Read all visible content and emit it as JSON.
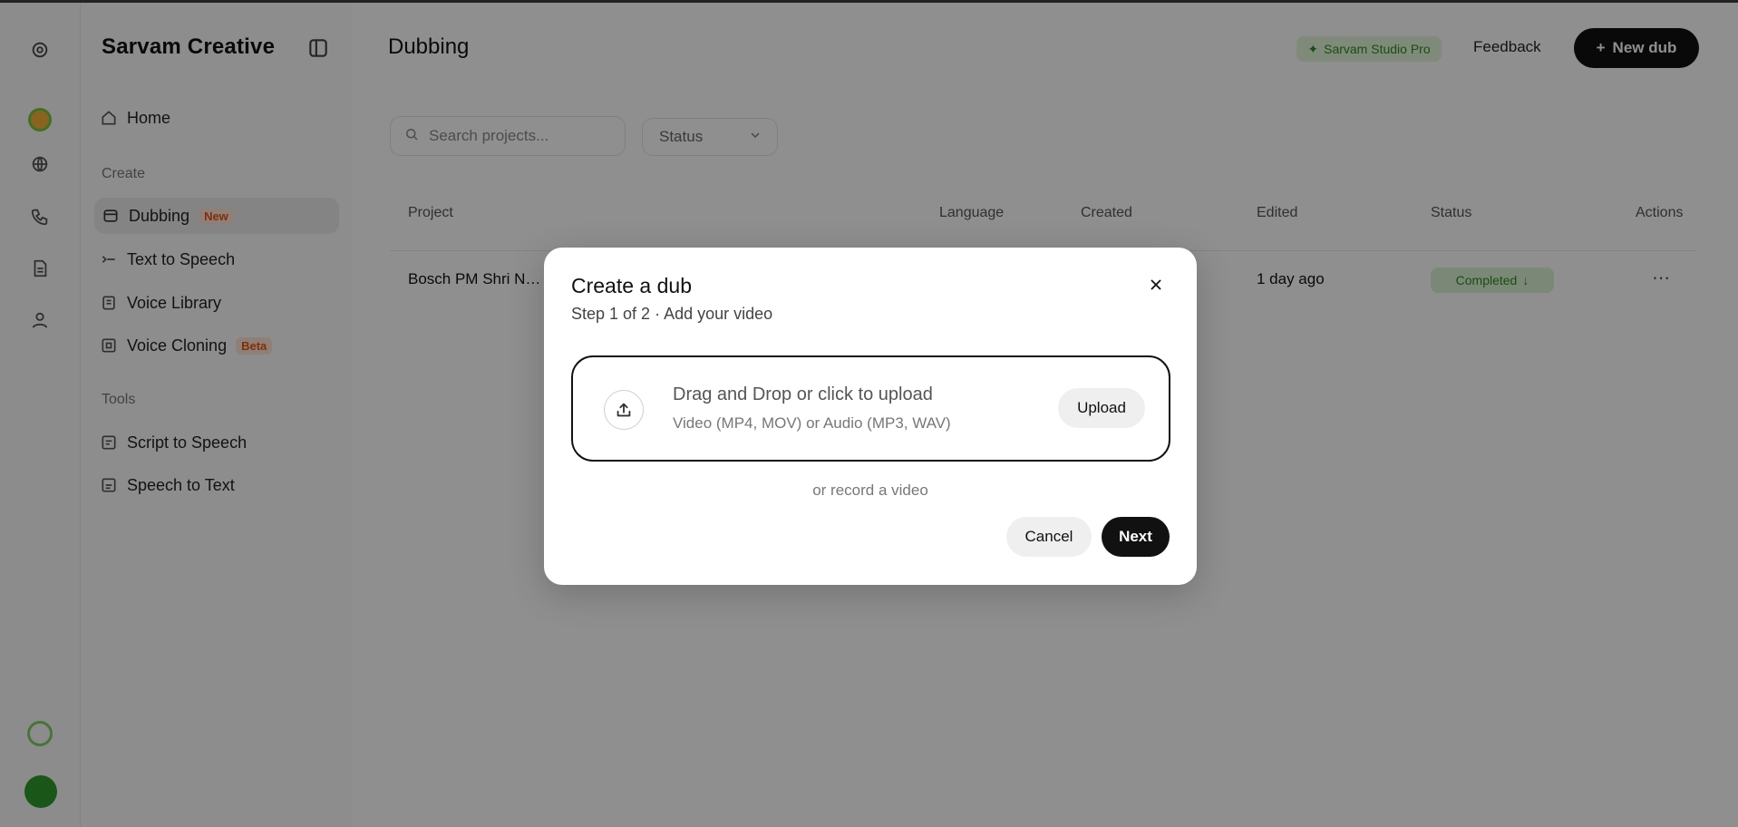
{
  "app": {
    "brand": "Sarvam Creative",
    "page_title": "Dubbing"
  },
  "header": {
    "credits_pill": "Sarvam Studio Pro",
    "feedback": "Feedback",
    "new_dub": "New dub"
  },
  "sidebar": {
    "home": "Home",
    "create_label": "Create",
    "items": [
      {
        "label": "Dubbing",
        "badge": "New"
      },
      {
        "label": "Text to Speech"
      },
      {
        "label": "Voice Library"
      },
      {
        "label": "Voice Cloning",
        "badge": "Beta"
      }
    ],
    "tools_label": "Tools",
    "tools": [
      {
        "label": "Script to Speech"
      },
      {
        "label": "Speech to Text"
      }
    ]
  },
  "filters": {
    "search_placeholder": "Search projects...",
    "status": "Status"
  },
  "table": {
    "columns": [
      "Project",
      "Language",
      "Created",
      "Edited",
      "Status",
      "Actions"
    ],
    "rows": [
      {
        "project": "Bosch PM Shri N…",
        "language": "",
        "created": "",
        "edited": "1 day ago",
        "status": "Completed"
      }
    ]
  },
  "modal": {
    "title": "Create a dub",
    "subtitle": "Step 1 of 2 · Add your video",
    "dropzone_title": "Drag and Drop or click to upload",
    "dropzone_sub": "Video (MP4, MOV) or Audio (MP3, WAV)",
    "upload": "Upload",
    "record": "or record a video",
    "cancel": "Cancel",
    "next": "Next"
  },
  "colors": {
    "accent": "#111111",
    "overlay": "rgba(0,0,0,0.44)",
    "new_badge": "#e8520f",
    "success": "#2f8a20"
  },
  "icons": [
    "logo-icon",
    "sun-icon",
    "globe-icon",
    "phone-icon",
    "document-icon",
    "person-icon",
    "status-ring-icon",
    "avatar-icon",
    "collapse-icon",
    "home-icon",
    "dubbing-icon",
    "tts-icon",
    "library-icon",
    "cloning-icon",
    "script-icon",
    "stt-icon",
    "search-icon",
    "chevron-down-icon",
    "plus-icon",
    "close-icon",
    "upload-icon"
  ]
}
